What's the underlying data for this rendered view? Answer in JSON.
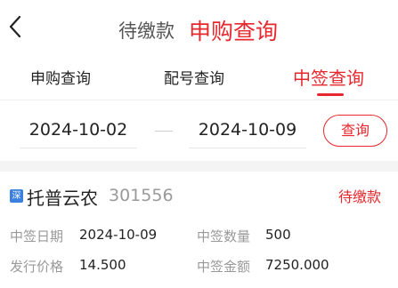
{
  "header": {
    "back_icon": "chevron-left-icon",
    "tab_pending": "待缴款",
    "tab_subscription": "申购查询"
  },
  "subtabs": {
    "items": [
      {
        "label": "申购查询"
      },
      {
        "label": "配号查询"
      },
      {
        "label": "中签查询"
      }
    ],
    "active_color": "#e6282e"
  },
  "filter": {
    "start_date": "2024-10-02",
    "end_date": "2024-10-09",
    "query_label": "查询"
  },
  "record": {
    "exchange_badge": "深",
    "name": "托普云农",
    "code": "301556",
    "status": "待缴款",
    "fields": {
      "win_date_label": "中签日期",
      "win_date_value": "2024-10-09",
      "win_qty_label": "中签数量",
      "win_qty_value": "500",
      "issue_price_label": "发行价格",
      "issue_price_value": "14.500",
      "win_amount_label": "中签金额",
      "win_amount_value": "7250.000"
    }
  },
  "colors": {
    "accent": "#e6282e",
    "badge": "#3b7fe0",
    "muted": "#999999"
  }
}
